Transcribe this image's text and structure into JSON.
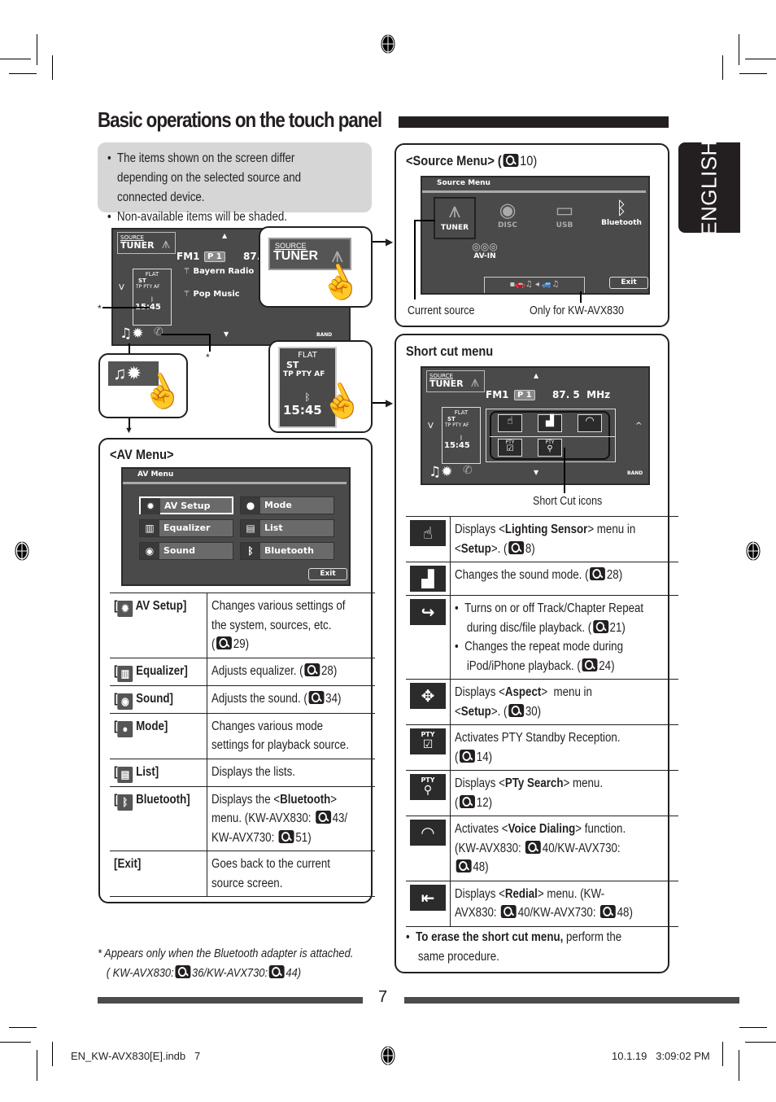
{
  "page": {
    "title": "Basic operations on the touch panel",
    "language_tab": "ENGLISH",
    "page_number": "7",
    "notes": [
      "The items shown on the screen differ depending on the selected source and connected device.",
      "Non-available items will be shaded."
    ],
    "footnote_line1": "*  Appears only when the Bluetooth adapter is attached.",
    "footnote_line2_a": "( KW-AVX830:",
    "footnote_line2_b": "36/KW-AVX730:",
    "footnote_line2_c": "44)",
    "footer_file": "EN_KW-AVX830[E].indb   7",
    "footer_timestamp": "10.1.19   3:09:02 PM"
  },
  "tuner_screen": {
    "source_label": "SOURCE",
    "source_value": "TUNER",
    "band": "FM1",
    "preset": "P 1",
    "frequency_partial": "87.",
    "frequency": "87. 5  MHz",
    "station": "Bayern Radio",
    "genre": "Pop Music",
    "eq": "FLAT",
    "st": "ST",
    "indicators": "TP  PTY  AF",
    "clock": "15:45",
    "band_button": "BAND",
    "asterisk": "*"
  },
  "source_menu": {
    "heading": "<Source Menu> (",
    "heading_ref": "10)",
    "screen_title": "Source Menu",
    "items": [
      {
        "label": "TUNER",
        "icon": "tower-icon",
        "glyph": "⩚"
      },
      {
        "label": "DISC",
        "icon": "disc-icon",
        "glyph": "◉"
      },
      {
        "label": "USB",
        "icon": "usb-icon",
        "glyph": "▭"
      },
      {
        "label": "Bluetooth",
        "icon": "bluetooth-icon",
        "glyph": "ᛒ"
      },
      {
        "label": "AV-IN",
        "icon": "av-cable-icon",
        "glyph": "◎◎◎"
      }
    ],
    "exit": "Exit",
    "caption_current": "Current source",
    "caption_only": "Only for KW-AVX830"
  },
  "av_menu": {
    "heading": "<AV Menu>",
    "screen_title": "AV Menu",
    "buttons": [
      {
        "label": "AV Setup",
        "glyph": "✹"
      },
      {
        "label": "Mode",
        "glyph": "●"
      },
      {
        "label": "Equalizer",
        "glyph": "▥"
      },
      {
        "label": "List",
        "glyph": "▤"
      },
      {
        "label": "Sound",
        "glyph": "◉"
      },
      {
        "label": "Bluetooth",
        "glyph": "ᛒ"
      }
    ],
    "exit": "Exit",
    "rows": [
      {
        "key": "AV Setup]",
        "glyph": "✹",
        "lines": [
          "Changes various settings of",
          "the system, sources, etc."
        ],
        "ref": "29)"
      },
      {
        "key": "Equalizer]",
        "glyph": "▥",
        "lines": [
          "Adjusts equalizer. ("
        ],
        "ref": "28)"
      },
      {
        "key": "Sound]",
        "glyph": "◉",
        "lines": [
          "Adjusts the sound. ("
        ],
        "ref": "34)"
      },
      {
        "key": "Mode]",
        "glyph": "●",
        "lines": [
          "Changes various mode",
          "settings for playback source."
        ],
        "ref": ""
      },
      {
        "key": "List]",
        "glyph": "▤",
        "lines": [
          "Displays the lists."
        ],
        "ref": ""
      },
      {
        "key": "Bluetooth]",
        "glyph": "ᛒ",
        "line1_a": "Displays the <",
        "line1_b": "Bluetooth",
        "line1_c": ">",
        "line2": "menu. (KW-AVX830:",
        "line2_ref": "43/",
        "line3": "KW-AVX730:",
        "line3_ref": "51)"
      },
      {
        "key": "[Exit]",
        "lines": [
          "Goes back to the current",
          "source screen."
        ]
      }
    ]
  },
  "short_cut": {
    "heading": "Short cut menu",
    "caption": "Short Cut icons",
    "rows": [
      {
        "glyph": "☝",
        "a": "Displays <",
        "b": "Lighting Sensor",
        "c": "> menu in",
        "d": "<",
        "e": "Setup",
        "f": ">. (",
        "ref": "8)"
      },
      {
        "glyph": "▟",
        "a": "Changes the sound mode. (",
        "ref": "28)"
      },
      {
        "glyph": "↪",
        "bullets": [
          "Turns on or off Track/Chapter Repeat",
          "during disc/file playback. (",
          "21)",
          "Changes the repeat mode during",
          "iPod/iPhone playback. (",
          "24)"
        ]
      },
      {
        "glyph": "✥",
        "a": "Displays <",
        "b": "Aspect",
        "c": ">  menu in",
        "d": "<",
        "e": "Setup",
        "f": ">. (",
        "ref": "30)"
      },
      {
        "glyph": "☑",
        "small": "PTY",
        "a": "Activates PTY Standby Reception.",
        "d": "(",
        "ref": "14)"
      },
      {
        "glyph": "⚲",
        "small": "PTY",
        "a": "Displays <",
        "b": "PTy Search",
        "c": "> menu.",
        "d": "(",
        "ref": "12)"
      },
      {
        "glyph": "◠",
        "a": "Activates <",
        "b": "Voice Dialing",
        "c": "> function.",
        "l2": "(KW-AVX830:",
        "l2ref": "40/KW-AVX730:",
        "l3ref": "48)"
      },
      {
        "glyph": "⇤",
        "a": "Displays <",
        "b": "Redial",
        "c": "> menu. (KW-",
        "l2": "AVX830:",
        "l2ref": "40/KW-AVX730:",
        "l2ref2": "48)"
      }
    ],
    "erase_bold": "To erase the short cut menu,",
    "erase_rest": " perform the",
    "erase_line2": "same procedure."
  }
}
